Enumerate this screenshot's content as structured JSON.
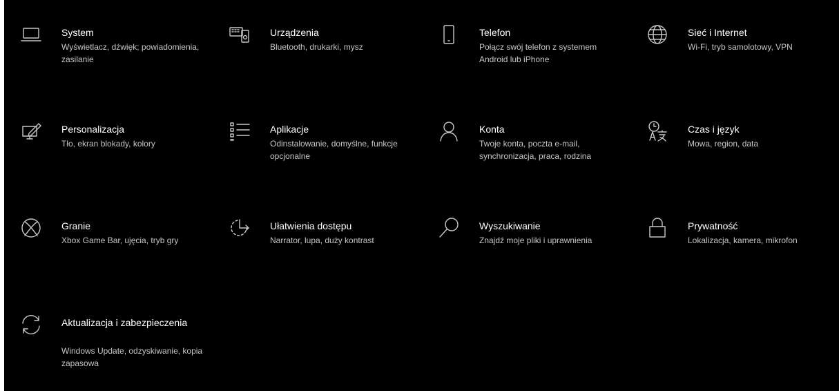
{
  "settings_tiles": [
    {
      "id": "system",
      "title": "System",
      "desc": "Wyświetlacz, dźwięk; powiadomienia, zasilanie",
      "icon": "laptop-icon"
    },
    {
      "id": "devices",
      "title": "Urządzenia",
      "desc": "Bluetooth, drukarki, mysz",
      "icon": "devices-icon"
    },
    {
      "id": "phone",
      "title": "Telefon",
      "desc": "Połącz swój telefon z systemem Android lub iPhone",
      "icon": "phone-icon"
    },
    {
      "id": "network",
      "title": "Sieć i Internet",
      "desc": "Wi-Fi, tryb samolotowy, VPN",
      "icon": "globe-icon"
    },
    {
      "id": "personalization",
      "title": "Personalizacja",
      "desc": "Tło, ekran blokady, kolory",
      "icon": "personalization-icon"
    },
    {
      "id": "apps",
      "title": "Aplikacje",
      "desc": "Odinstalowanie, domyślne, funkcje opcjonalne",
      "icon": "apps-list-icon"
    },
    {
      "id": "accounts",
      "title": "Konta",
      "desc": "Twoje konta, poczta e-mail, synchronizacja, praca, rodzina",
      "icon": "person-icon"
    },
    {
      "id": "time-language",
      "title": "Czas i język",
      "desc": "Mowa, region, data",
      "icon": "time-language-icon"
    },
    {
      "id": "gaming",
      "title": "Granie",
      "desc": "Xbox Game Bar, ujęcia, tryb gry",
      "icon": "xbox-icon"
    },
    {
      "id": "ease-of-access",
      "title": "Ułatwienia dostępu",
      "desc": "Narrator, lupa, duży kontrast",
      "icon": "ease-of-access-icon"
    },
    {
      "id": "search",
      "title": "Wyszukiwanie",
      "desc": "Znajdź moje pliki i uprawnienia",
      "icon": "search-icon"
    },
    {
      "id": "privacy",
      "title": "Prywatność",
      "desc": "Lokalizacja, kamera, mikrofon",
      "icon": "lock-icon"
    },
    {
      "id": "update-security",
      "title": "Aktualizacja i zabezpieczenia",
      "desc": "Windows Update, odzyskiwanie, kopia zapasowa",
      "icon": "sync-icon"
    }
  ]
}
